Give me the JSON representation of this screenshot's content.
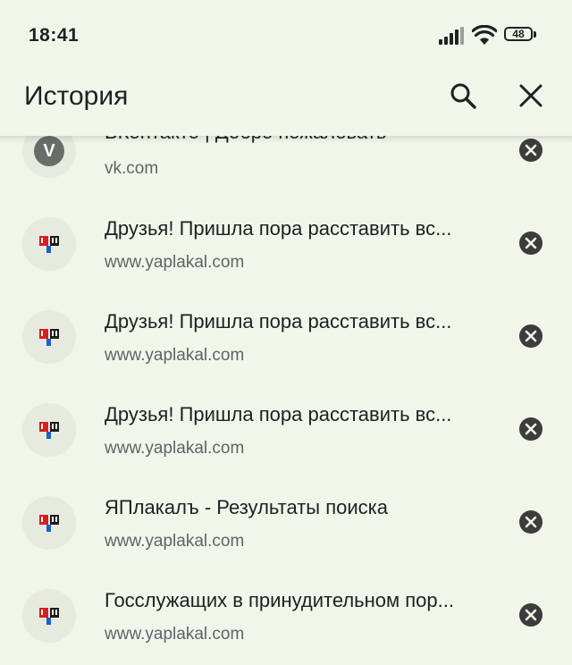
{
  "status_bar": {
    "time": "18:41",
    "battery": "48",
    "icons": [
      "signal-icon",
      "wifi-icon",
      "battery-icon"
    ]
  },
  "toolbar": {
    "title": "История",
    "search_icon": "search-icon",
    "close_icon": "close-icon"
  },
  "history": {
    "items": [
      {
        "title": "ВКонтакте | Добро пожаловать",
        "url": "vk.com",
        "favicon": "vk-icon"
      },
      {
        "title": "Друзья! Пришла пора расставить вс...",
        "url": "www.yaplakal.com",
        "favicon": "yaplakal-icon"
      },
      {
        "title": "Друзья! Пришла пора расставить вс...",
        "url": "www.yaplakal.com",
        "favicon": "yaplakal-icon"
      },
      {
        "title": "Друзья! Пришла пора расставить вс...",
        "url": "www.yaplakal.com",
        "favicon": "yaplakal-icon"
      },
      {
        "title": "ЯПлакалъ - Результаты поиска",
        "url": "www.yaplakal.com",
        "favicon": "yaplakal-icon"
      },
      {
        "title": "Госслужащих в принудительном пор...",
        "url": "www.yaplakal.com",
        "favicon": "yaplakal-icon"
      }
    ],
    "vk_letter": "V",
    "remove_icon": "remove-circle-icon"
  },
  "colors": {
    "background": "#f2f6ea",
    "text": "#202124",
    "secondary_text": "#5f6368",
    "remove_button": "#3c3c3c"
  }
}
